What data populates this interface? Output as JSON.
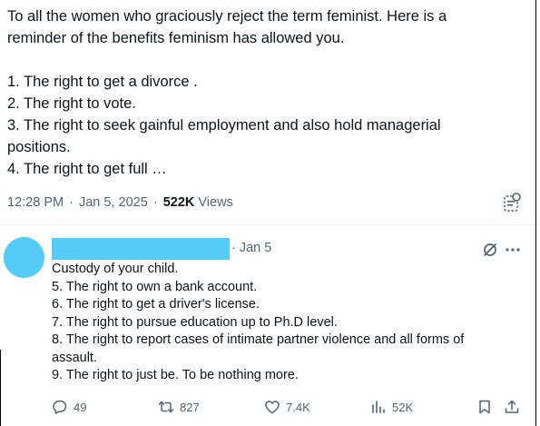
{
  "tweet": {
    "lines": [
      "To all the women who graciously reject the term feminist. Here is a",
      "reminder of the benefits feminism has allowed you.",
      "",
      "1. The right to get a divorce .",
      "2. The right to vote.",
      "3. The right to seek gainful employment and also hold managerial",
      "positions.",
      "4. The right to get full …"
    ],
    "time": "12:28 PM",
    "separator": "·",
    "date": "Jan 5, 2025",
    "views_count": "522K",
    "views_label": "Views"
  },
  "reply": {
    "date": "· Jan 5",
    "lines": [
      "Custody of your child.",
      "5. The right to own a bank account.",
      "6. The right to get a driver's license.",
      "7. The right to pursue education up to Ph.D level.",
      "8. The right to report cases of intimate partner violence and all forms of",
      "assault.",
      "9. The right to just be. To be nothing more."
    ],
    "actions": {
      "replies": "49",
      "reposts": "827",
      "likes": "7.4K",
      "views": "52K"
    }
  },
  "colors": {
    "redaction": "#55ccf7",
    "text": "#0f1419",
    "muted": "#536471"
  },
  "icons": [
    "grok-icon",
    "grok-reply-icon",
    "more-icon",
    "reply-icon",
    "repost-icon",
    "like-icon",
    "views-icon",
    "bookmark-icon",
    "share-icon"
  ]
}
